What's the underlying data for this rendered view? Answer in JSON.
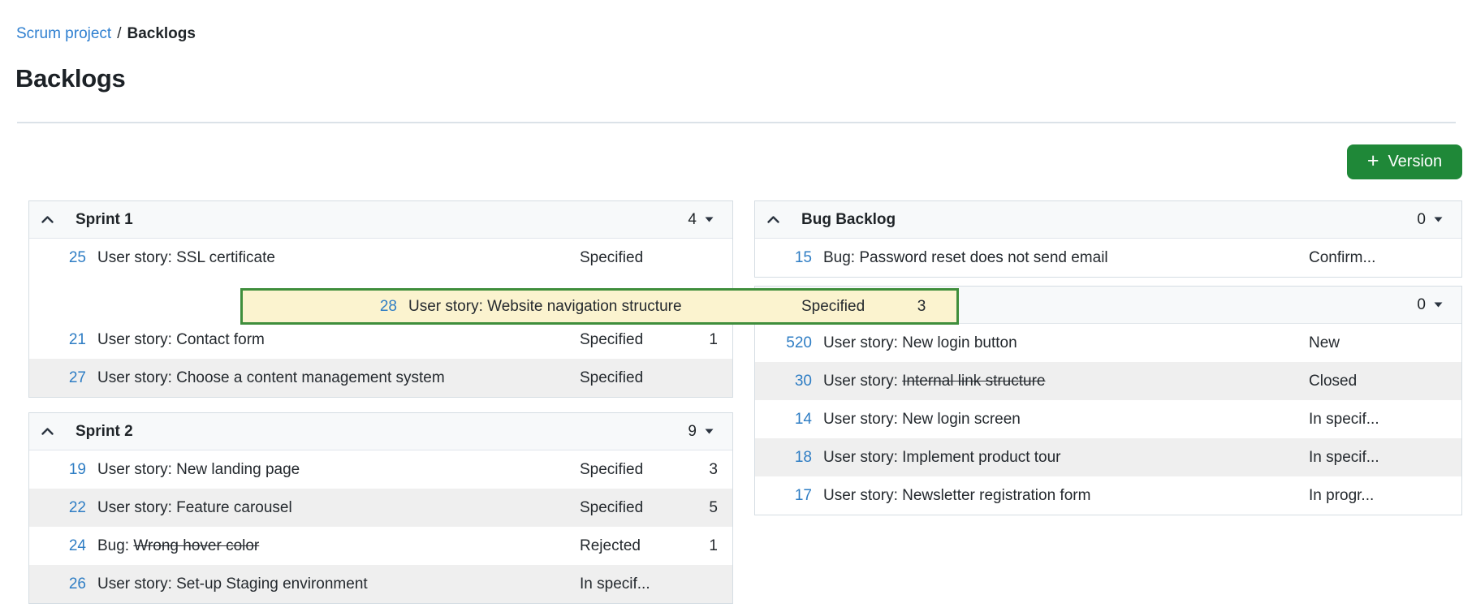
{
  "breadcrumb": {
    "project": "Scrum project",
    "separator": "/",
    "current": "Backlogs"
  },
  "page_title": "Backlogs",
  "toolbar": {
    "version_button_label": "Version",
    "plus_icon": "+"
  },
  "colors": {
    "accent_green": "#1f8838",
    "drag_border_green": "#3f8e3c",
    "drag_background_yellow": "#fbf3cf",
    "link_blue": "#2e7fd0",
    "id_blue": "#2e7dc4",
    "panel_header_bg": "#f7f9fa",
    "shaded_row_bg": "#efefef",
    "panel_border": "#d5dde3"
  },
  "panels": {
    "left": [
      {
        "title": "Sprint 1",
        "count": "4",
        "rows": [
          {
            "id": "25",
            "prefix": "User story:",
            "name": "SSL certificate",
            "struck": false,
            "status": "Specified",
            "effort": "",
            "shaded": false
          },
          {
            "gap": true
          },
          {
            "id": "21",
            "prefix": "User story:",
            "name": "Contact form",
            "struck": false,
            "status": "Specified",
            "effort": "1",
            "shaded": false
          },
          {
            "id": "27",
            "prefix": "User story:",
            "name": "Choose a content management system",
            "struck": false,
            "status": "Specified",
            "effort": "",
            "shaded": true
          }
        ]
      },
      {
        "title": "Sprint 2",
        "count": "9",
        "rows": [
          {
            "id": "19",
            "prefix": "User story:",
            "name": "New landing page",
            "struck": false,
            "status": "Specified",
            "effort": "3",
            "shaded": false
          },
          {
            "id": "22",
            "prefix": "User story:",
            "name": "Feature carousel",
            "struck": false,
            "status": "Specified",
            "effort": "5",
            "shaded": true
          },
          {
            "id": "24",
            "prefix": "Bug:",
            "name": "Wrong hover color",
            "struck": true,
            "status": "Rejected",
            "effort": "1",
            "shaded": false
          },
          {
            "id": "26",
            "prefix": "User story:",
            "name": "Set-up Staging environment",
            "struck": false,
            "status": "In specif...",
            "effort": "",
            "shaded": true
          }
        ]
      }
    ],
    "right": [
      {
        "title": "Bug Backlog",
        "count": "0",
        "rows": [
          {
            "id": "15",
            "prefix": "Bug:",
            "name": "Password reset does not send email",
            "struck": false,
            "status": "Confirm...",
            "effort": "",
            "shaded": false
          }
        ]
      },
      {
        "title": "",
        "count": "0",
        "rows": [
          {
            "id": "520",
            "prefix": "User story:",
            "name": "New login button",
            "struck": false,
            "status": "New",
            "effort": "",
            "shaded": false
          },
          {
            "id": "30",
            "prefix": "User story:",
            "name": "Internal link structure",
            "struck": true,
            "status": "Closed",
            "effort": "",
            "shaded": true
          },
          {
            "id": "14",
            "prefix": "User story:",
            "name": "New login screen",
            "struck": false,
            "status": "In specif...",
            "effort": "",
            "shaded": false
          },
          {
            "id": "18",
            "prefix": "User story:",
            "name": "Implement product tour",
            "struck": false,
            "status": "In specif...",
            "effort": "",
            "shaded": true
          },
          {
            "id": "17",
            "prefix": "User story:",
            "name": "Newsletter registration form",
            "struck": false,
            "status": "In progr...",
            "effort": "",
            "shaded": false
          }
        ]
      }
    ]
  },
  "drag_row": {
    "id": "28",
    "prefix": "User story:",
    "name": "Website navigation structure",
    "status": "Specified",
    "effort": "3"
  }
}
